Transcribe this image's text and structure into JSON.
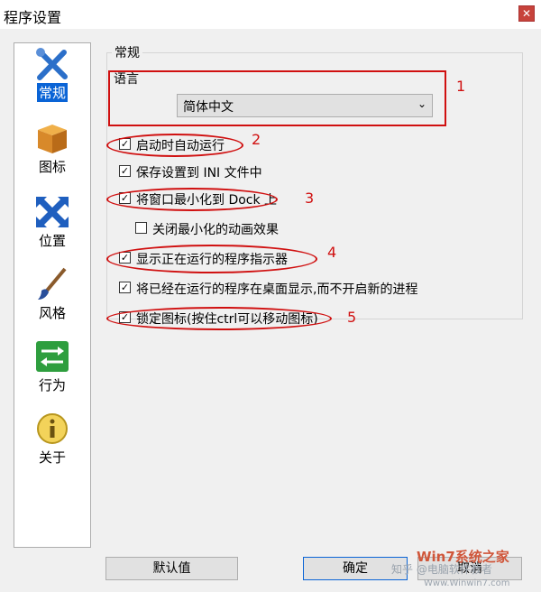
{
  "window": {
    "title": "程序设置",
    "close_glyph": "✕"
  },
  "sidebar": {
    "items": [
      {
        "label": "常规",
        "icon": "tools-icon",
        "selected": true
      },
      {
        "label": "图标",
        "icon": "box-icon",
        "selected": false
      },
      {
        "label": "位置",
        "icon": "arrows-icon",
        "selected": false
      },
      {
        "label": "风格",
        "icon": "brush-icon",
        "selected": false
      },
      {
        "label": "行为",
        "icon": "swap-arrows-icon",
        "selected": false
      },
      {
        "label": "关于",
        "icon": "info-icon",
        "selected": false
      }
    ]
  },
  "general": {
    "group_title": "常规",
    "language_label": "语言",
    "language_value": "简体中文",
    "options": [
      {
        "label": "启动时自动运行",
        "checked": true
      },
      {
        "label": "保存设置到 INI 文件中",
        "checked": true
      },
      {
        "label": "将窗口最小化到 Dock 上",
        "checked": true
      },
      {
        "label": "关闭最小化的动画效果",
        "checked": false
      },
      {
        "label": "显示正在运行的程序指示器",
        "checked": true
      },
      {
        "label": "将已经在运行的程序在桌面显示,而不开启新的进程",
        "checked": true
      },
      {
        "label": "锁定图标(按住ctrl可以移动图标)",
        "checked": true
      }
    ]
  },
  "annotations": [
    "1",
    "2",
    "3",
    "4",
    "5"
  ],
  "footer": {
    "defaults_label": "默认值",
    "ok_label": "确定",
    "cancel_label": "取消"
  },
  "watermarks": {
    "zhihu": "知乎 @电脑软件教者",
    "site": "Win7系统之家",
    "url": "Www.Winwin7.com"
  },
  "colors": {
    "annotation": "#d01010",
    "selection": "#0a64d6"
  }
}
